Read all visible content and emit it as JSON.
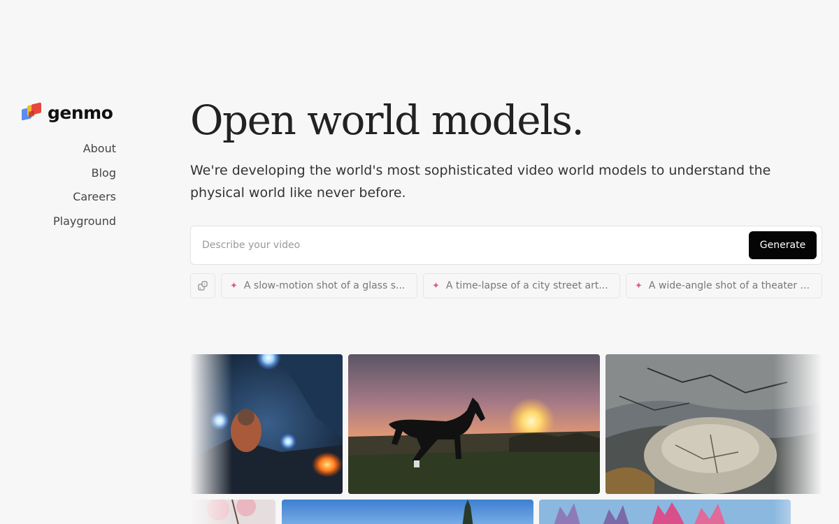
{
  "brand": {
    "name": "genmo"
  },
  "nav": {
    "items": [
      "About",
      "Blog",
      "Careers",
      "Playground"
    ]
  },
  "hero": {
    "title": "Open world models.",
    "subtitle": "We're developing the world's most sophisticated video world models to understand the physical world like never before."
  },
  "prompt": {
    "placeholder": "Describe your video",
    "value": "",
    "generate_label": "Generate"
  },
  "suggestions": {
    "shuffle_icon": "shuffle-icon",
    "items": [
      "A slow-motion shot of a glass s...",
      "A time-lapse of a city street art...",
      "A wide-angle shot of a theater ..."
    ]
  },
  "colors": {
    "background": "#f7f7f7",
    "button": "#050505",
    "sparkle": "#e0607a"
  }
}
